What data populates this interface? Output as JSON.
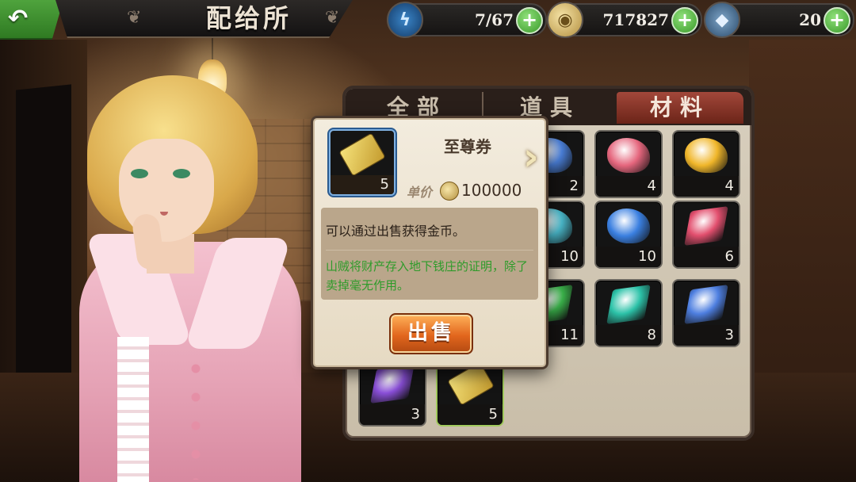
{
  "header": {
    "title": "配给所",
    "back_icon": "back-arrow-icon"
  },
  "resources": {
    "energy": {
      "value": "7/67",
      "icon": "lightning-icon"
    },
    "gold": {
      "value": "717827",
      "icon": "coin-icon"
    },
    "gem": {
      "value": "20",
      "icon": "gem-icon"
    }
  },
  "tabs": [
    {
      "label": "全部",
      "active": false
    },
    {
      "label": "道具",
      "active": false
    },
    {
      "label": "材料",
      "active": true
    }
  ],
  "inventory": [
    {
      "qty": "2",
      "kind": "ore",
      "color": "#4a7fd8"
    },
    {
      "qty": "4",
      "kind": "ore",
      "color": "#e5667d"
    },
    {
      "qty": "4",
      "kind": "ore",
      "color": "#f0b62a"
    },
    {
      "qty": "10",
      "kind": "ore",
      "color": "#49b6c8"
    },
    {
      "qty": "10",
      "kind": "ore",
      "color": "#3a7fe0"
    },
    {
      "qty": "6",
      "kind": "shard",
      "color": "#e24f6e"
    },
    {
      "qty": "11",
      "kind": "shard",
      "color": "#3ab14a"
    },
    {
      "qty": "8",
      "kind": "shard",
      "color": "#2cc2a8"
    },
    {
      "qty": "3",
      "kind": "shard",
      "color": "#4e7fe0"
    },
    {
      "qty": "3",
      "kind": "shard",
      "color": "#8a4fd8"
    },
    {
      "qty": "5",
      "kind": "ticket",
      "color": "#e8c94a"
    }
  ],
  "popup": {
    "item_name": "至尊券",
    "qty": "5",
    "price_label": "单价",
    "price": "100000",
    "description": "可以通过出售获得金币。",
    "flavor": "山贼将财产存入地下钱庄的证明，除了卖掉毫无作用。",
    "sell_label": "出售",
    "next_icon": "chevron-right-icon"
  },
  "colors": {
    "accent_green": "#3a9a2a",
    "sell_orange": "#e2661d",
    "flavor_green": "#2e9b2a"
  }
}
